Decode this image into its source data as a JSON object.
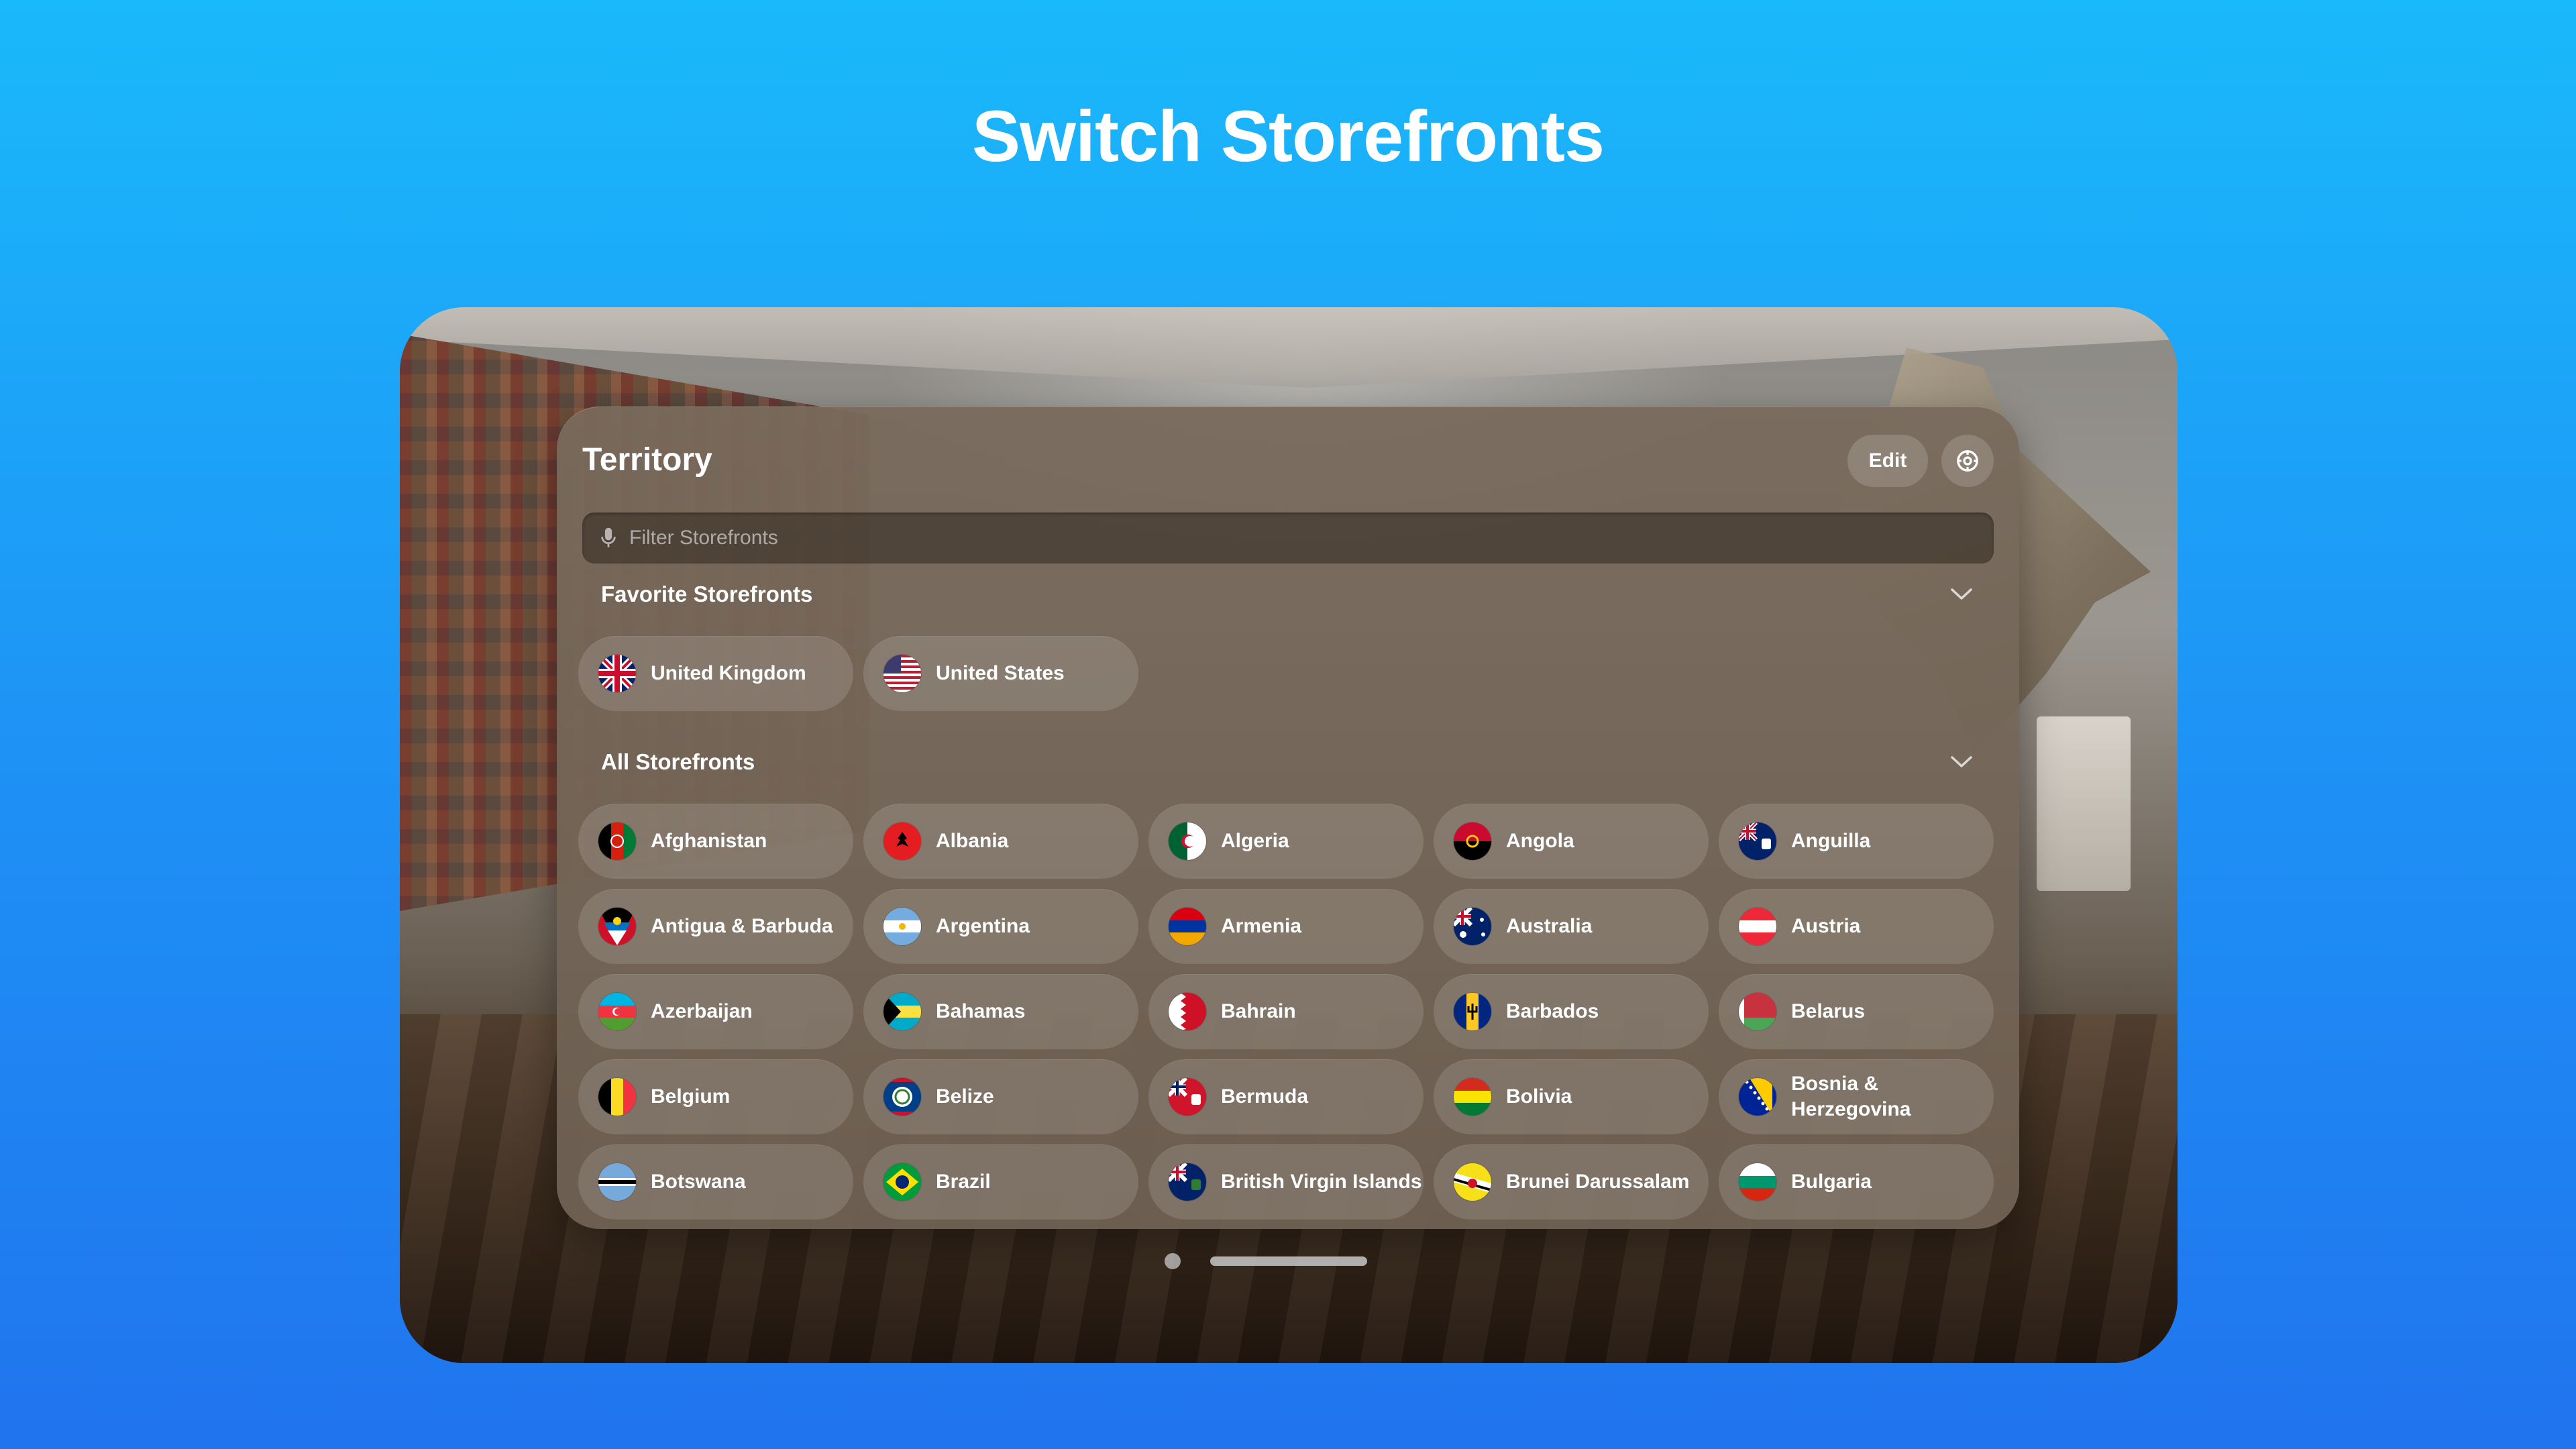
{
  "promo": {
    "title": "Switch Storefronts"
  },
  "window": {
    "title": "Territory",
    "edit_label": "Edit",
    "settings_icon": "gear-icon",
    "search": {
      "placeholder": "Filter Storefronts",
      "value": "",
      "icon": "microphone-icon"
    }
  },
  "favorites": {
    "title": "Favorite Storefronts",
    "items": [
      {
        "label": "United Kingdom",
        "flag": "gb"
      },
      {
        "label": "United States",
        "flag": "us"
      }
    ]
  },
  "all": {
    "title": "All Storefronts",
    "items": [
      {
        "label": "Afghanistan",
        "flag": "af"
      },
      {
        "label": "Albania",
        "flag": "al"
      },
      {
        "label": "Algeria",
        "flag": "dz"
      },
      {
        "label": "Angola",
        "flag": "ao"
      },
      {
        "label": "Anguilla",
        "flag": "ai"
      },
      {
        "label": "Antigua & Barbuda",
        "flag": "ag"
      },
      {
        "label": "Argentina",
        "flag": "ar"
      },
      {
        "label": "Armenia",
        "flag": "am"
      },
      {
        "label": "Australia",
        "flag": "au"
      },
      {
        "label": "Austria",
        "flag": "at"
      },
      {
        "label": "Azerbaijan",
        "flag": "az"
      },
      {
        "label": "Bahamas",
        "flag": "bs"
      },
      {
        "label": "Bahrain",
        "flag": "bh"
      },
      {
        "label": "Barbados",
        "flag": "bb"
      },
      {
        "label": "Belarus",
        "flag": "by"
      },
      {
        "label": "Belgium",
        "flag": "be"
      },
      {
        "label": "Belize",
        "flag": "bz"
      },
      {
        "label": "Bermuda",
        "flag": "bm"
      },
      {
        "label": "Bolivia",
        "flag": "bo"
      },
      {
        "label": "Bosnia & Herzegovina",
        "flag": "ba"
      },
      {
        "label": "Botswana",
        "flag": "bw"
      },
      {
        "label": "Brazil",
        "flag": "br"
      },
      {
        "label": "British Virgin Islands",
        "flag": "vg"
      },
      {
        "label": "Brunei Darussalam",
        "flag": "bn"
      },
      {
        "label": "Bulgaria",
        "flag": "bg"
      }
    ]
  },
  "pager": {
    "pages": 1,
    "current": 1
  }
}
